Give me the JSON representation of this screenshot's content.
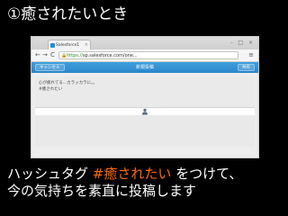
{
  "slide": {
    "title": "①癒されたいとき",
    "caption_line1_prefix": "ハッシュタグ ",
    "caption_hashtag": "#癒されたい",
    "caption_line1_suffix": " をつけて、",
    "caption_line2": "今の気持ちを素直に投稿します",
    "hashtag_color": "#ff6a00"
  },
  "browser": {
    "tab_title": "Salesforce1",
    "tab_close": "×",
    "window_controls": "- □ ×",
    "nav_back": "←",
    "nav_forward": "→",
    "nav_reload": "C",
    "lock_icon": "🔒",
    "url_scheme": "https://",
    "url_rest": "sp.salesforce.com/one...",
    "menu_icon": "≡"
  },
  "publisher": {
    "cancel_label": "キャンセル",
    "title": "新規投稿",
    "share_label": "共有",
    "header_color": "#2a85c8",
    "post_line1": "心が疲れてる...カラッカラに。。",
    "post_line2": "#癒されたい",
    "attach_icon": "person-attach-icon"
  }
}
